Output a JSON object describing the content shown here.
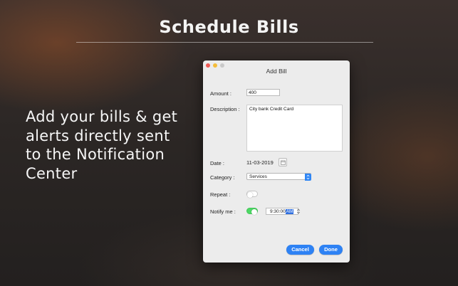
{
  "headline": "Schedule Bills",
  "tagline": "Add your bills & get alerts directly sent to the Notification Center",
  "dialog": {
    "title": "Add Bill",
    "fields": {
      "amount_label": "Amount :",
      "amount_value": "400",
      "description_label": "Description :",
      "description_value": "City bank Credit Card",
      "date_label": "Date :",
      "date_value": "11-03-2019",
      "category_label": "Category :",
      "category_value": "Services",
      "repeat_label": "Repeat :",
      "repeat_on": false,
      "notify_label": "Notify me :",
      "notify_on": true,
      "notify_time": "9:30:00",
      "notify_ampm": "AM"
    },
    "buttons": {
      "cancel": "Cancel",
      "done": "Done"
    }
  },
  "colors": {
    "accent": "#2e82f4",
    "toggle_on": "#4cd964",
    "close_light": "#ee5b56",
    "minimize_light": "#f5bd3a"
  },
  "icons": [
    "calendar-icon",
    "chevron-updown-icon",
    "stepper-icon"
  ]
}
